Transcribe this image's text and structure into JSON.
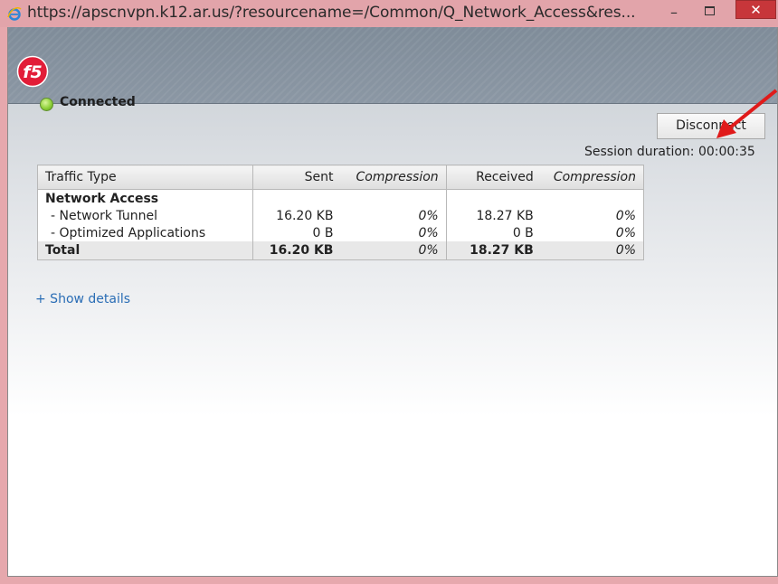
{
  "window": {
    "title": "https://apscnvpn.k12.ar.us/?resourcename=/Common/Q_Network_Access&res...",
    "minimize": "–",
    "close": "✕"
  },
  "logo": {
    "text": "f5"
  },
  "status": {
    "label": "Connected",
    "color": "#8fd13a"
  },
  "actions": {
    "disconnect_label": "Disconnect"
  },
  "session": {
    "duration_text": "Session duration: 00:00:35"
  },
  "table": {
    "headers": {
      "type": "Traffic Type",
      "sent": "Sent",
      "sent_compression": "Compression",
      "received": "Received",
      "received_compression": "Compression"
    },
    "group_label": "Network Access",
    "rows": [
      {
        "type": "- Network Tunnel",
        "sent": "16.20 KB",
        "sent_comp": "0%",
        "received": "18.27 KB",
        "recv_comp": "0%"
      },
      {
        "type": "- Optimized Applications",
        "sent": "0 B",
        "sent_comp": "0%",
        "received": "0 B",
        "recv_comp": "0%"
      }
    ],
    "total": {
      "type": "Total",
      "sent": "16.20 KB",
      "sent_comp": "0%",
      "received": "18.27 KB",
      "recv_comp": "0%"
    }
  },
  "details": {
    "link_label": "+ Show details"
  },
  "colors": {
    "accent_link": "#2a6db5",
    "arrow": "#e01a1a",
    "titlebar": "#e2a4aa",
    "close": "#c7363a"
  }
}
